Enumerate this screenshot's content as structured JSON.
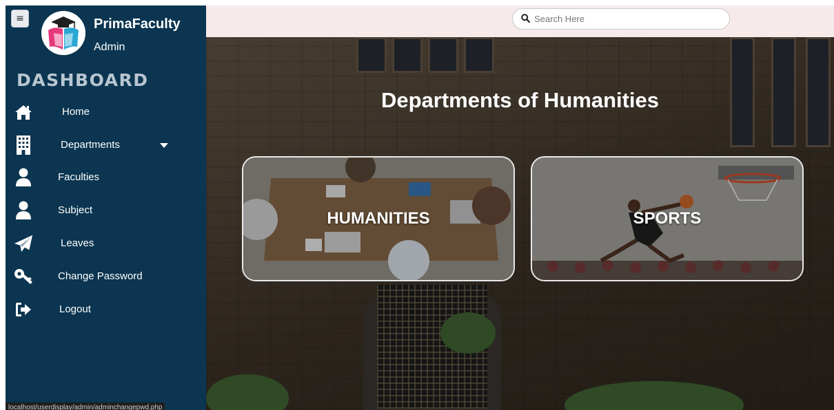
{
  "sidebar": {
    "brand_name": "PrimaFaculty",
    "brand_role": "Admin",
    "section_title": "DASHBOARD",
    "items": [
      {
        "label": "Home",
        "icon": "home-icon"
      },
      {
        "label": "Departments",
        "icon": "building-icon",
        "has_dropdown": true
      },
      {
        "label": "Faculties",
        "icon": "user-icon"
      },
      {
        "label": "Subject",
        "icon": "user-icon"
      },
      {
        "label": "Leaves",
        "icon": "paper-plane-icon"
      },
      {
        "label": "Change Password",
        "icon": "key-icon"
      },
      {
        "label": "Logout",
        "icon": "sign-out-icon"
      }
    ],
    "status_url": "localhost/userdisplay/admin/adminchangepwd.php"
  },
  "topbar": {
    "search_placeholder": "Search Here"
  },
  "main": {
    "title": "Departments of Humanities",
    "cards": [
      {
        "label": "HUMANITIES"
      },
      {
        "label": "SPORTS"
      }
    ]
  },
  "colors": {
    "sidebar_bg": "#0b3550",
    "topbar_bg": "#f6eaea",
    "text_light": "#ffffff",
    "section_title": "#b9c6d1"
  }
}
